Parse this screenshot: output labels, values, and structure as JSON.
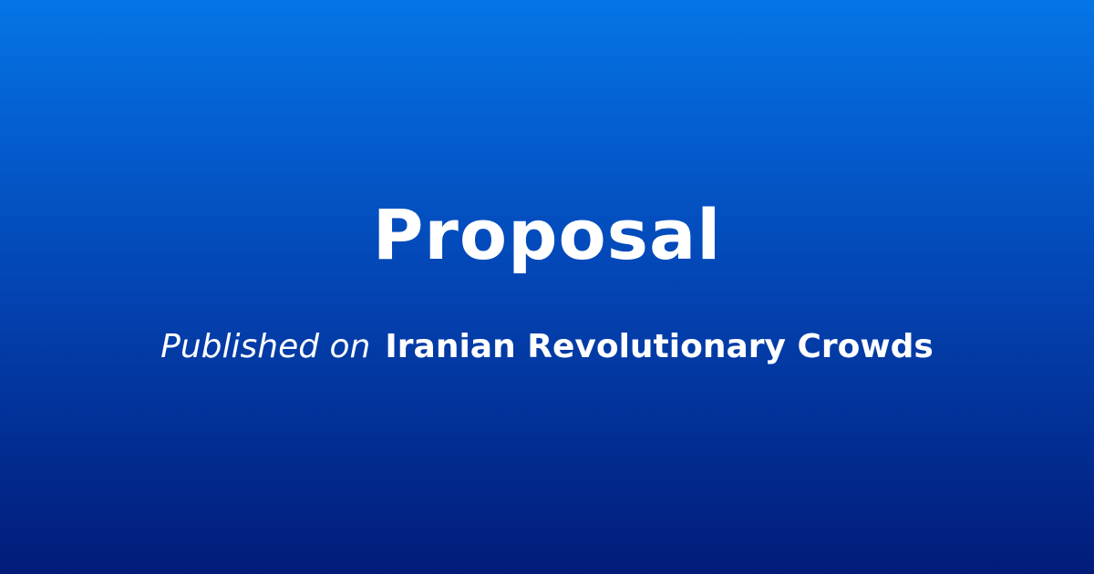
{
  "title": "Proposal",
  "subtitle": {
    "prefix": "Published on",
    "site_name": "Iranian Revolutionary Crowds"
  },
  "colors": {
    "gradient_top": "#0575e6",
    "gradient_bottom": "#021b79",
    "text": "#ffffff"
  }
}
